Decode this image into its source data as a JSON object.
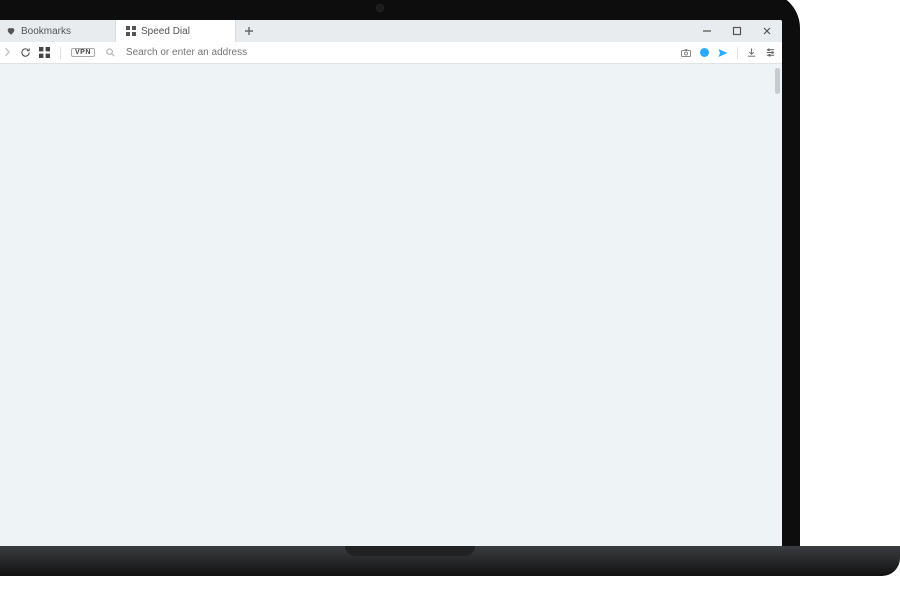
{
  "tabs": {
    "pinned_label": "Bookmarks",
    "active_label": "Speed Dial"
  },
  "addressbar": {
    "vpn_label": "VPN",
    "placeholder": "Search or enter an address"
  }
}
